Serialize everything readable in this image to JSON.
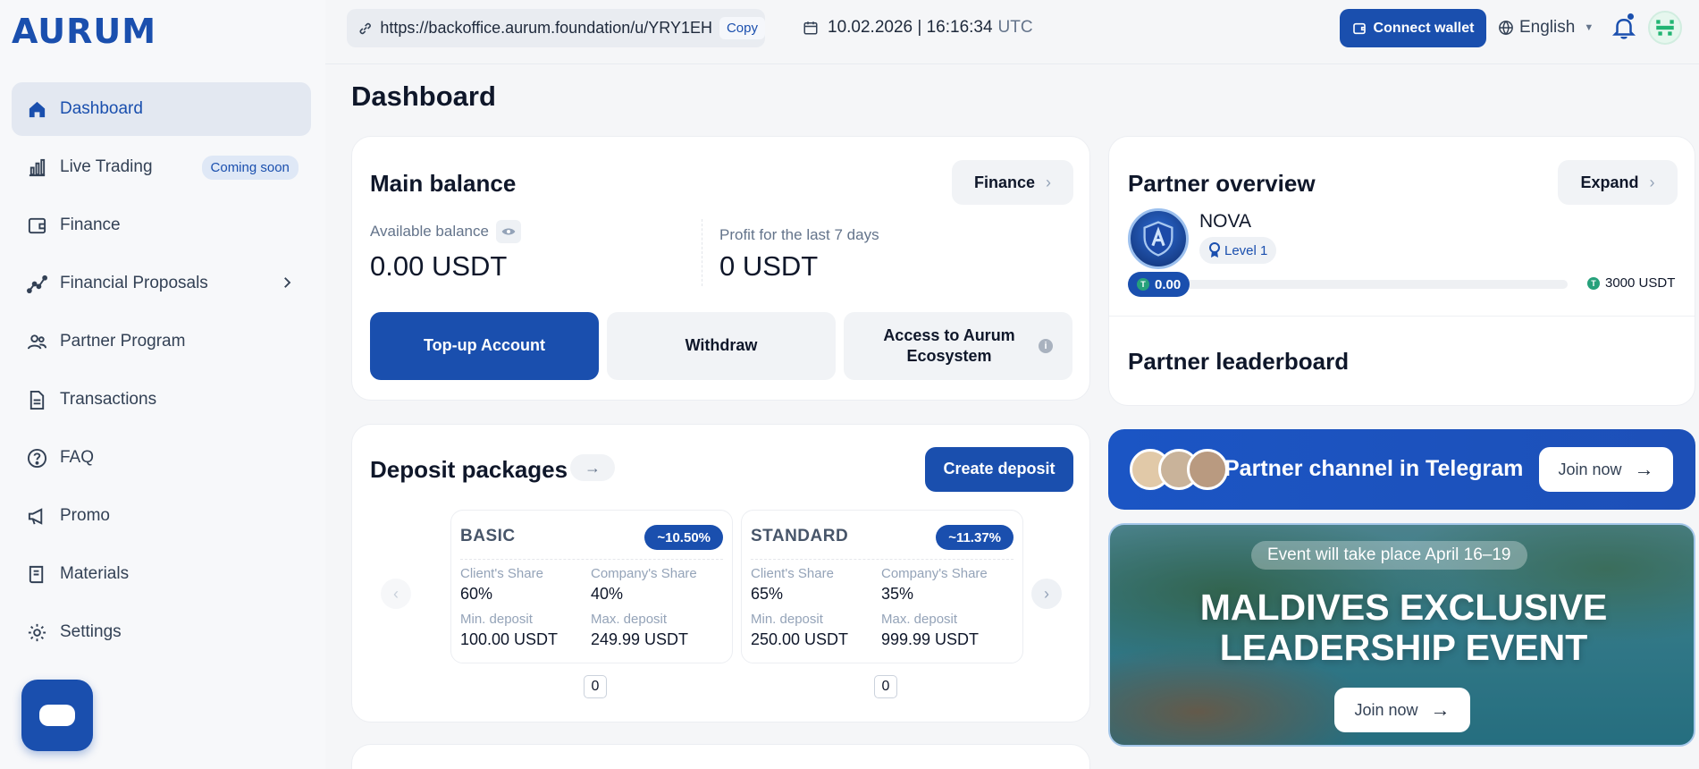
{
  "app": {
    "logo": "AURUM"
  },
  "header": {
    "url": "https://backoffice.aurum.foundation/u/YRY1EH",
    "copy_label": "Copy",
    "datetime": "10.02.2026 | 16:16:34",
    "timezone": "UTC",
    "connect_wallet_label": "Connect wallet",
    "language": "English"
  },
  "sidebar": {
    "items": [
      {
        "label": "Dashboard",
        "icon": "home-icon",
        "active": true
      },
      {
        "label": "Live Trading",
        "icon": "chart-bars-icon",
        "badge": "Coming soon"
      },
      {
        "label": "Finance",
        "icon": "wallet-icon"
      },
      {
        "label": "Financial Proposals",
        "icon": "trend-line-icon",
        "expandable": true
      },
      {
        "label": "Partner Program",
        "icon": "users-icon"
      },
      {
        "label": "Transactions",
        "icon": "document-icon"
      },
      {
        "label": "FAQ",
        "icon": "question-circle-icon"
      },
      {
        "label": "Promo",
        "icon": "megaphone-icon"
      },
      {
        "label": "Materials",
        "icon": "book-icon"
      },
      {
        "label": "Settings",
        "icon": "gear-icon"
      }
    ]
  },
  "main": {
    "page_title": "Dashboard",
    "balance_card": {
      "title": "Main balance",
      "finance_label": "Finance",
      "available_label": "Available balance",
      "available_value": "0.00 USDT",
      "profit_label": "Profit for the last 7 days",
      "profit_value": "0 USDT",
      "topup_label": "Top-up Account",
      "withdraw_label": "Withdraw",
      "access_label": "Access to Aurum Ecosystem"
    },
    "deposit_card": {
      "title": "Deposit packages",
      "create_label": "Create deposit",
      "packages": [
        {
          "name": "BASIC",
          "rate": "~10.50%",
          "client_share_label": "Client's Share",
          "client_share": "60%",
          "company_share_label": "Company's Share",
          "company_share": "40%",
          "min_label": "Min. deposit",
          "min": "100.00 USDT",
          "max_label": "Max. deposit",
          "max": "249.99 USDT",
          "count": "0"
        },
        {
          "name": "STANDARD",
          "rate": "~11.37%",
          "client_share_label": "Client's Share",
          "client_share": "65%",
          "company_share_label": "Company's Share",
          "company_share": "35%",
          "min_label": "Min. deposit",
          "min": "250.00 USDT",
          "max_label": "Max. deposit",
          "max": "999.99 USDT",
          "count": "0"
        }
      ]
    },
    "partner_card": {
      "title": "Partner overview",
      "expand_label": "Expand",
      "rank": "NOVA",
      "level": "Level 1",
      "progress_value": "0.00",
      "progress_target": "3000 USDT",
      "progress_fraction": 0,
      "leaderboard_title": "Partner leaderboard"
    },
    "telegram_banner": {
      "text": "Partner channel in Telegram",
      "join_label": "Join now"
    },
    "event_banner": {
      "date_text": "Event will take place April 16–19",
      "title_line1": "MALDIVES EXCLUSIVE",
      "title_line2": "LEADERSHIP EVENT",
      "join_label": "Join now"
    }
  },
  "colors": {
    "brand": "#1a4fae",
    "tether": "#26a17b"
  }
}
